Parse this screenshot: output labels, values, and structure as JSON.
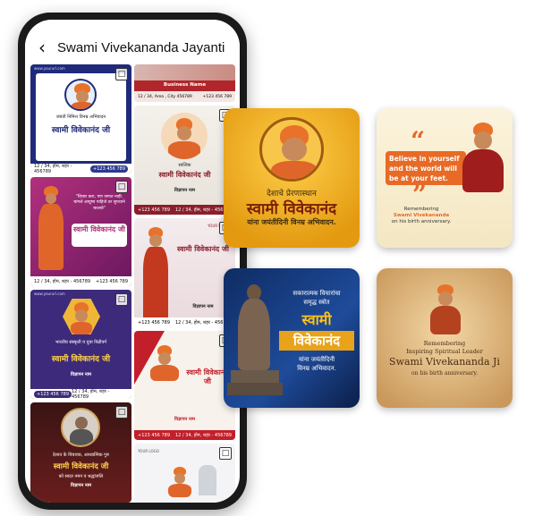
{
  "app": {
    "title": "Swami Vivekananda Jayanti"
  },
  "colors": {
    "accent_orange": "#e8722a",
    "navy": "#1f2b7a",
    "magenta": "#8b1d6d",
    "purple": "#3d2a7a"
  },
  "left_column": [
    {
      "top_small": "www.yoururl.com",
      "subtitle": "जयंती निमित्त विनम्र अभिवादन",
      "name": "स्वामी विवेकानंद जी",
      "signature": "विज्ञापन नाम",
      "address": "12 / 34, होम, शहर - 456789",
      "phone": "+123 456 789"
    },
    {
      "quote": "\"विचार करा, पण जगात नाही. चांगले आयुष्य पाहिजे तर सुपथाने चालावे\"",
      "name": "स्वामी विवेकानंद जी",
      "address": "12 / 34, होम, शहर - 456789",
      "phone": "+123 456 789"
    },
    {
      "top_small": "www.yoururl.com",
      "subtitle": "भारतीय संस्कृती व युवा पिढीवर्ग",
      "name": "स्वामी विवेकानंद जी",
      "signature": "विज्ञापन नाम",
      "phone": "+123 456 789",
      "address": "12 / 34, होम, शहर - 456789"
    },
    {
      "subtitle": "देशात के विचारक, आध्यात्मिक गुरु",
      "name": "स्वामी विवेकानंद जी",
      "tagline": "को सादर नमन व श्रद्धांजलि",
      "signature": "विज्ञापन नाम"
    }
  ],
  "right_column": [
    {
      "business": "Business Name",
      "address": "12 / 34, Area , City 456789",
      "phone": "+123 456 789"
    },
    {
      "top": "सात्विक",
      "title": "स्वामी विवेकानंद जी",
      "signature": "विज्ञापन नाम",
      "phone": "+123 456 789",
      "address": "12 / 34, होम, शहर - 456789"
    },
    {
      "logo": "YOUR LOGO",
      "title": "स्वामी विवेकानंद जी",
      "signature": "विज्ञापन नाम",
      "phone": "+123 456 789",
      "address": "12 / 34, होम, शहर - 456789"
    },
    {
      "title": "स्वामी विवेकानंद जी",
      "signature": "विज्ञापन नाम",
      "phone": "+123 456 789",
      "address": "12 / 34, होम, शहर - 456789"
    },
    {
      "logo": "YOUR LOGO"
    }
  ],
  "tiles": [
    {
      "line1": "देशाचे प्रेरणास्थान",
      "line2": "स्वामी विवेकानंद",
      "line3": "यांना जयंतीदिनी विनम्र अभिवादन."
    },
    {
      "quote_line1": "Believe in yourself",
      "quote_line2": "and the world will",
      "quote_line3": "be at your feet.",
      "caption1": "Remembering",
      "caption2": "Swami Vivekananda",
      "caption3": "on his birth anniversary."
    },
    {
      "line1": "सकारात्मक विचारांचा",
      "line2": "समृद्ध स्त्रोत",
      "line3": "स्वामी",
      "line4": "विवेकानंद",
      "line5": "यांना जयंतीदिनी",
      "line6": "विनम्र अभिवादन."
    },
    {
      "line1": "Remembering",
      "line2": "Inspiring Spiritual Leader",
      "line3": "Swami Vivekananda Ji",
      "line4": "on his birth anniversary."
    }
  ]
}
